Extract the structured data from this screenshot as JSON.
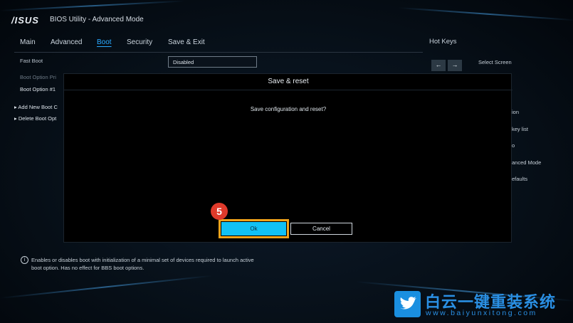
{
  "header": {
    "brand": "/ISUS",
    "title": "BIOS Utility - Advanced Mode"
  },
  "menu": {
    "items": [
      {
        "label": "Main"
      },
      {
        "label": "Advanced"
      },
      {
        "label": "Boot",
        "active": true
      },
      {
        "label": "Security"
      },
      {
        "label": "Save & Exit"
      }
    ]
  },
  "boot": {
    "fast_boot_label": "Fast Boot",
    "fast_boot_value": "Disabled",
    "boot_option_priorities": "Boot Option Pri",
    "boot_option_1": "Boot Option #1",
    "add_new_boot": "▸ Add New Boot C",
    "delete_boot": "▸ Delete Boot Opt"
  },
  "hotkeys": {
    "title": "Hot Keys",
    "left_arrow": "←",
    "right_arrow": "→",
    "select_screen": "Select Screen",
    "items": [
      "ion",
      "key list",
      "o",
      "anced Mode",
      "efaults"
    ]
  },
  "help": {
    "icon": "info-icon",
    "text": "Enables or disables boot with initialization of a minimal set of devices required to launch active boot option. Has no effect for BBS boot options."
  },
  "dialog": {
    "title": "Save & reset",
    "message": "Save configuration and reset?",
    "ok_label": "Ok",
    "cancel_label": "Cancel"
  },
  "annotation": {
    "step_number": "5",
    "highlight_color": "#f2a31b",
    "badge_color": "#e03a2b"
  },
  "watermark": {
    "icon": "twitter-bird-icon",
    "chinese": "白云一键重装系统",
    "url": "www.baiyunxitong.com"
  },
  "colors": {
    "accent": "#2aa9ff",
    "ok_button": "#11c1f5"
  }
}
